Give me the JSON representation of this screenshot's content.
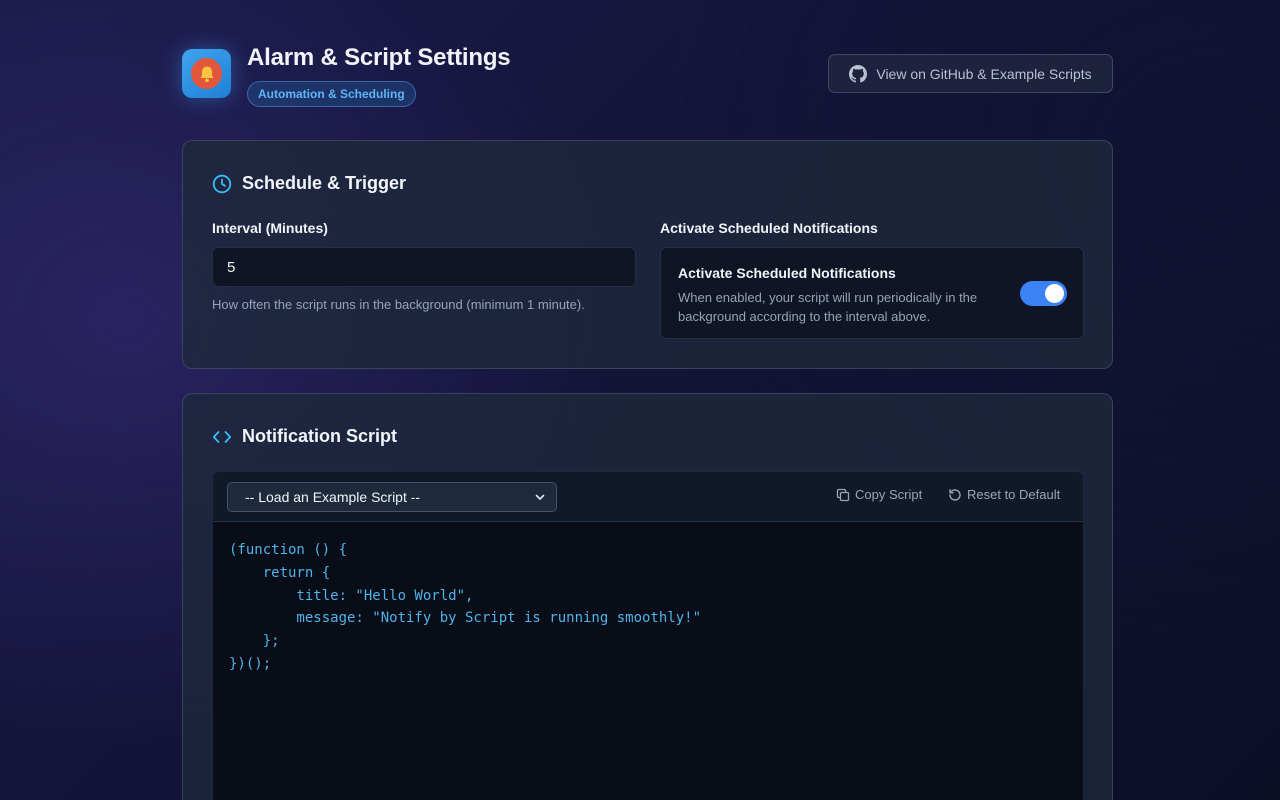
{
  "header": {
    "title": "Alarm & Script Settings",
    "tag": "Automation & Scheduling",
    "github_button": "View on GitHub & Example Scripts",
    "icons": {
      "app": "bell-icon",
      "github": "github-icon"
    }
  },
  "schedule": {
    "title": "Schedule & Trigger",
    "interval_label": "Interval (Minutes)",
    "interval_value": "5",
    "interval_help": "How often the script runs in the background (minimum 1 minute).",
    "activate_section_label": "Activate Scheduled Notifications",
    "activate_title": "Activate Scheduled Notifications",
    "activate_description": "When enabled, your script will run periodically in the background according to the interval above.",
    "activate_enabled": true,
    "icons": {
      "section": "clock-icon"
    }
  },
  "script": {
    "title": "Notification Script",
    "select_placeholder": "-- Load an Example Script --",
    "copy_label": "Copy Script",
    "reset_label": "Reset to Default",
    "code": "(function () {\n    return {\n        title: \"Hello World\",\n        message: \"Notify by Script is running smoothly!\"\n    };\n})();",
    "icons": {
      "section": "code-icon",
      "copy": "copy-icon",
      "reset": "reset-icon",
      "select": "chevron-down-icon"
    }
  },
  "colors": {
    "accent": "#3b82f6",
    "code_text": "#4fb3e8",
    "tag_text": "#60b4f6",
    "section_icon": "#38bdf8"
  }
}
